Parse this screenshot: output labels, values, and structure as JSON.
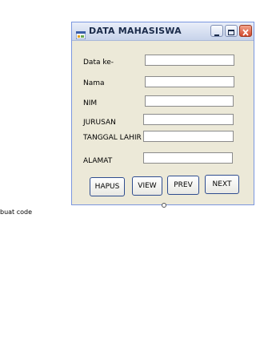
{
  "window": {
    "title": "DATA MAHASISWA",
    "icons": {
      "app": "app-window-icon",
      "minimize": "minimize-icon",
      "maximize": "maximize-icon",
      "close": "close-icon"
    },
    "colors": {
      "face": "#ece9d8",
      "close_button": "#d2472a"
    }
  },
  "form": {
    "labels": {
      "data_ke": "Data ke-",
      "nama": "Nama",
      "nim": "NIM",
      "jurusan": "JURUSAN",
      "tanggal_lahir": "TANGGAL LAHIR",
      "alamat": "ALAMAT"
    },
    "values": {
      "data_ke": "",
      "nama": "",
      "nim": "",
      "jurusan": "",
      "tanggal_lahir": "",
      "alamat": ""
    }
  },
  "buttons": {
    "hapus": "HAPUS",
    "view": "VIEW",
    "prev": "PREV",
    "next": "NEXT"
  },
  "caption": "buat code"
}
